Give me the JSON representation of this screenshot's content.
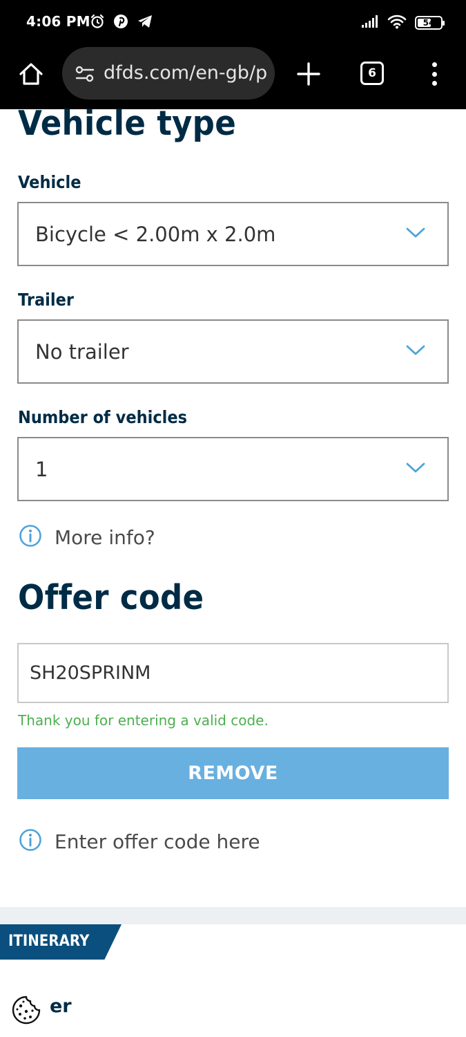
{
  "status_bar": {
    "time": "4:06 PM",
    "battery": "54"
  },
  "browser": {
    "url": "dfds.com/en-gb/p",
    "tab_count": "6"
  },
  "vehicle_section": {
    "title": "Vehicle type",
    "vehicle": {
      "label": "Vehicle",
      "value": "Bicycle < 2.00m x 2.0m"
    },
    "trailer": {
      "label": "Trailer",
      "value": "No trailer"
    },
    "count": {
      "label": "Number of vehicles",
      "value": "1"
    },
    "more_info": "More info?"
  },
  "offer_section": {
    "title": "Offer code",
    "code_value": "SH20SPRINM",
    "valid_message": "Thank you for entering a valid code.",
    "remove_label": "REMOVE",
    "enter_code_hint": "Enter offer code here"
  },
  "itinerary": {
    "tab_label": "ITINERARY",
    "partial_text": "er"
  },
  "colors": {
    "heading": "#002b45",
    "button": "#68b0e0",
    "success": "#4caf50",
    "tab": "#0a4f7d",
    "chevron": "#4da3d8"
  }
}
